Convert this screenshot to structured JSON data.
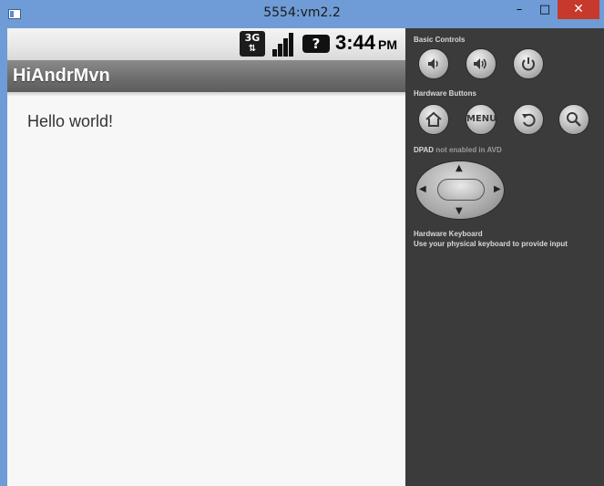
{
  "window": {
    "title": "5554:vm2.2",
    "min_glyph": "–",
    "max_glyph": "□",
    "close_glyph": "✕"
  },
  "statusbar": {
    "network": "3G",
    "network_arrows": "⇅",
    "unknown_glyph": "?",
    "time": "3:44",
    "ampm": "PM"
  },
  "app": {
    "title": "HiAndrMvn",
    "body_text": "Hello world!"
  },
  "controls": {
    "basic_label": "Basic Controls",
    "hardware_label": "Hardware Buttons",
    "menu_label": "MENU",
    "dpad_label": "DPAD",
    "dpad_note": "not enabled in AVD",
    "keyboard_label": "Hardware Keyboard",
    "keyboard_note": "Use your physical keyboard to provide input",
    "icons": [
      "volume-down-icon",
      "volume-up-icon",
      "power-icon",
      "home-icon",
      "back-icon",
      "search-icon"
    ]
  },
  "colors": {
    "window_frame": "#6f9bd6",
    "close_button": "#c7392b",
    "panel_bg": "#3b3b3b",
    "action_bar": "#6e6e6e"
  }
}
